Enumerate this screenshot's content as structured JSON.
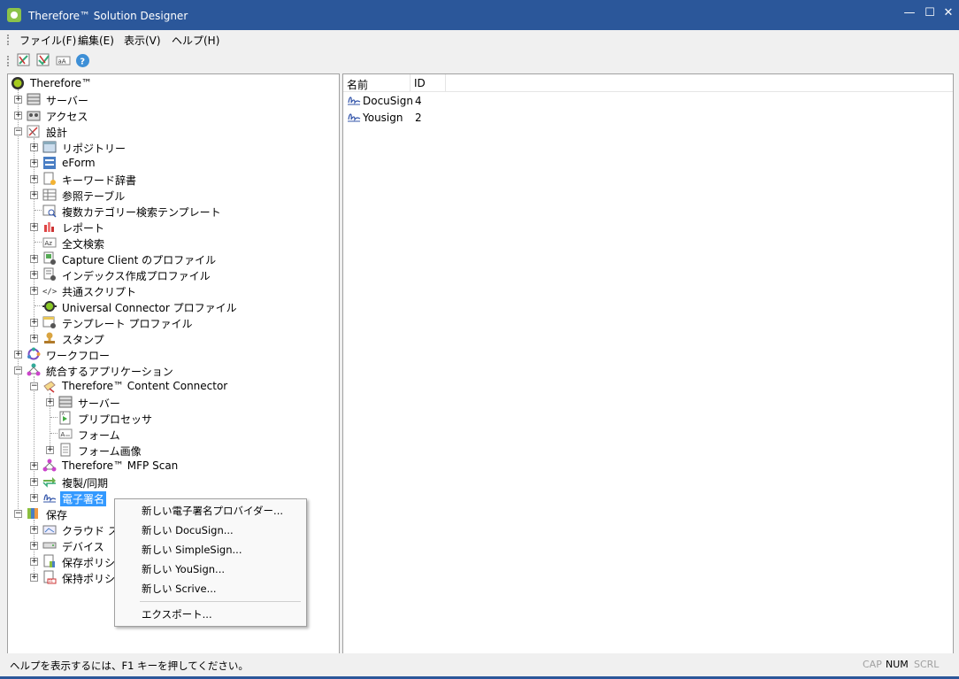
{
  "window": {
    "title": "Therefore™ Solution Designer",
    "minimize": "—",
    "maximize": "☐",
    "close": "✕"
  },
  "menu": [
    "ファイル(F)",
    "編集(E)",
    "表示(V)",
    "ヘルプ(H)"
  ],
  "tree": {
    "root": "Therefore™",
    "server": "サーバー",
    "access": "アクセス",
    "design": "設計",
    "repository": "リポジトリー",
    "eform": "eForm",
    "keyword_dict": "キーワード辞書",
    "reference_table": "参照テーブル",
    "multi_cat_template": "複数カテゴリー検索テンプレート",
    "report": "レポート",
    "fulltext": "全文検索",
    "capture_client": "Capture Client のプロファイル",
    "index_profile": "インデックス作成プロファイル",
    "common_script": "共通スクリプト",
    "universal_connector": "Universal Connector プロファイル",
    "template_profile": "テンプレート プロファイル",
    "stamp": "スタンプ",
    "workflow": "ワークフロー",
    "integrated_apps": "統合するアプリケーション",
    "content_connector": "Therefore™ Content Connector",
    "cc_server": "サーバー",
    "preprocessor": "プリプロセッサ",
    "form": "フォーム",
    "form_image": "フォーム画像",
    "mfp_scan": "Therefore™ MFP Scan",
    "replication": "複製/同期",
    "esign": "電子署名",
    "storage": "保存",
    "cloud_storage": "クラウド スト",
    "device": "デバイス",
    "storage_policy": "保存ポリシ",
    "retention_policy": "保持ポリシ"
  },
  "list": {
    "columns": [
      "名前",
      "ID"
    ],
    "rows": [
      {
        "name": "DocuSign",
        "id": "4"
      },
      {
        "name": "Yousign",
        "id": "2"
      }
    ]
  },
  "context_menu": {
    "new_provider": "新しい電子署名プロバイダー...",
    "new_docusign": "新しい DocuSign...",
    "new_simplesign": "新しい SimpleSign...",
    "new_yousign": "新しい YouSign...",
    "new_scrive": "新しい Scrive...",
    "export": "エクスポート..."
  },
  "status": {
    "help": "ヘルプを表示するには、F1 キーを押してください。",
    "cap": "CAP",
    "num": "NUM",
    "scrl": "SCRL"
  },
  "colors": {
    "titlebar": "#2b579a",
    "selection": "#3399ff"
  }
}
